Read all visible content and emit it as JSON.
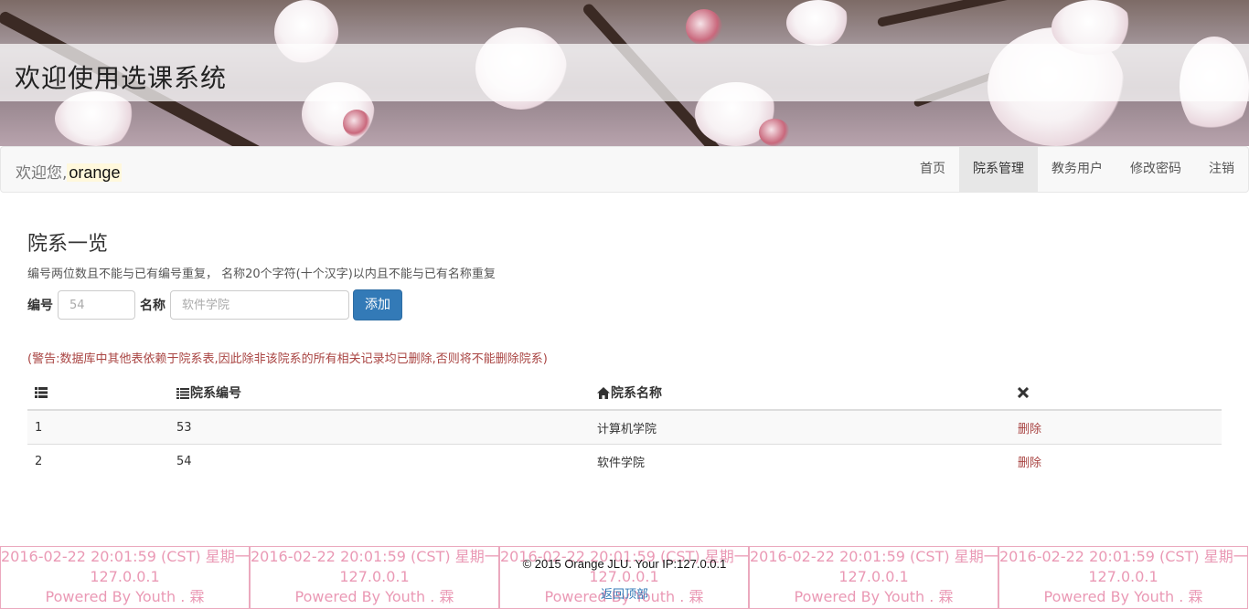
{
  "header": {
    "title": "欢迎使用选课系统"
  },
  "navbar": {
    "welcome_prefix": "欢迎您,",
    "username": "orange",
    "items": [
      {
        "label": "首页",
        "active": false
      },
      {
        "label": "院系管理",
        "active": true
      },
      {
        "label": "教务用户",
        "active": false
      },
      {
        "label": "修改密码",
        "active": false
      },
      {
        "label": "注销",
        "active": false
      }
    ]
  },
  "main": {
    "heading": "院系一览",
    "hint": "编号两位数且不能与已有编号重复， 名称20个字符(十个汉字)以内且不能与已有名称重复",
    "form": {
      "num_label": "编号",
      "num_placeholder": "54",
      "name_label": "名称",
      "name_placeholder": "软件学院",
      "add_label": "添加"
    },
    "warning": "(警告:数据库中其他表依赖于院系表,因此除非该院系的所有相关记录均已删除,否则将不能删除院系)",
    "table": {
      "columns": [
        "",
        "院系编号",
        "院系名称",
        ""
      ],
      "column_icons": [
        "list-icon",
        "th-list-icon",
        "home-icon",
        "remove-icon"
      ],
      "rows": [
        {
          "index": "1",
          "code": "53",
          "name": "计算机学院",
          "action": "删除"
        },
        {
          "index": "2",
          "code": "54",
          "name": "软件学院",
          "action": "删除"
        }
      ]
    }
  },
  "footer": {
    "copyright": "© 2015 Orange JLU. Your IP:127.0.0.1",
    "back_to_top": "返回顶部",
    "watermark": {
      "line1": "2016-02-22 20:01:59 (CST) 星期一",
      "line2": "127.0.0.1",
      "line3": "Powered By Youth . 霖"
    }
  }
}
